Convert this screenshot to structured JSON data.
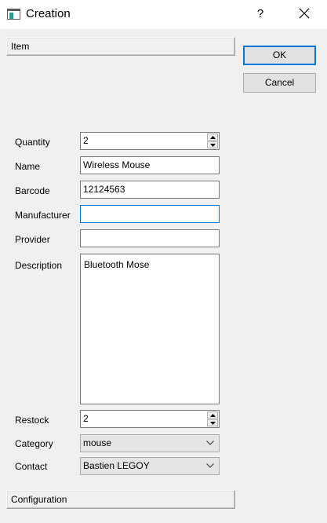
{
  "window": {
    "title": "Creation",
    "help_label": "?"
  },
  "sections": {
    "item": "Item",
    "configuration": "Configuration"
  },
  "buttons": {
    "ok": "OK",
    "cancel": "Cancel"
  },
  "form": {
    "quantity": {
      "label": "Quantity",
      "value": "2"
    },
    "name": {
      "label": "Name",
      "value": "Wireless Mouse"
    },
    "barcode": {
      "label": "Barcode",
      "value": "12124563"
    },
    "manufacturer": {
      "label": "Manufacturer",
      "value": ""
    },
    "provider": {
      "label": "Provider",
      "value": ""
    },
    "description": {
      "label": "Description",
      "value": "Bluetooth Mose"
    },
    "restock": {
      "label": "Restock",
      "value": "2"
    },
    "category": {
      "label": "Category",
      "value": "mouse"
    },
    "contact": {
      "label": "Contact",
      "value": "Bastien LEGOY"
    }
  },
  "icons": {
    "app": "window-icon",
    "close": "close-icon",
    "spin_up": "spin-up-icon",
    "spin_down": "spin-down-icon",
    "dropdown": "chevron-down-icon"
  },
  "colors": {
    "focus_border": "#0078d7",
    "window_bg": "#f0f0f0"
  }
}
